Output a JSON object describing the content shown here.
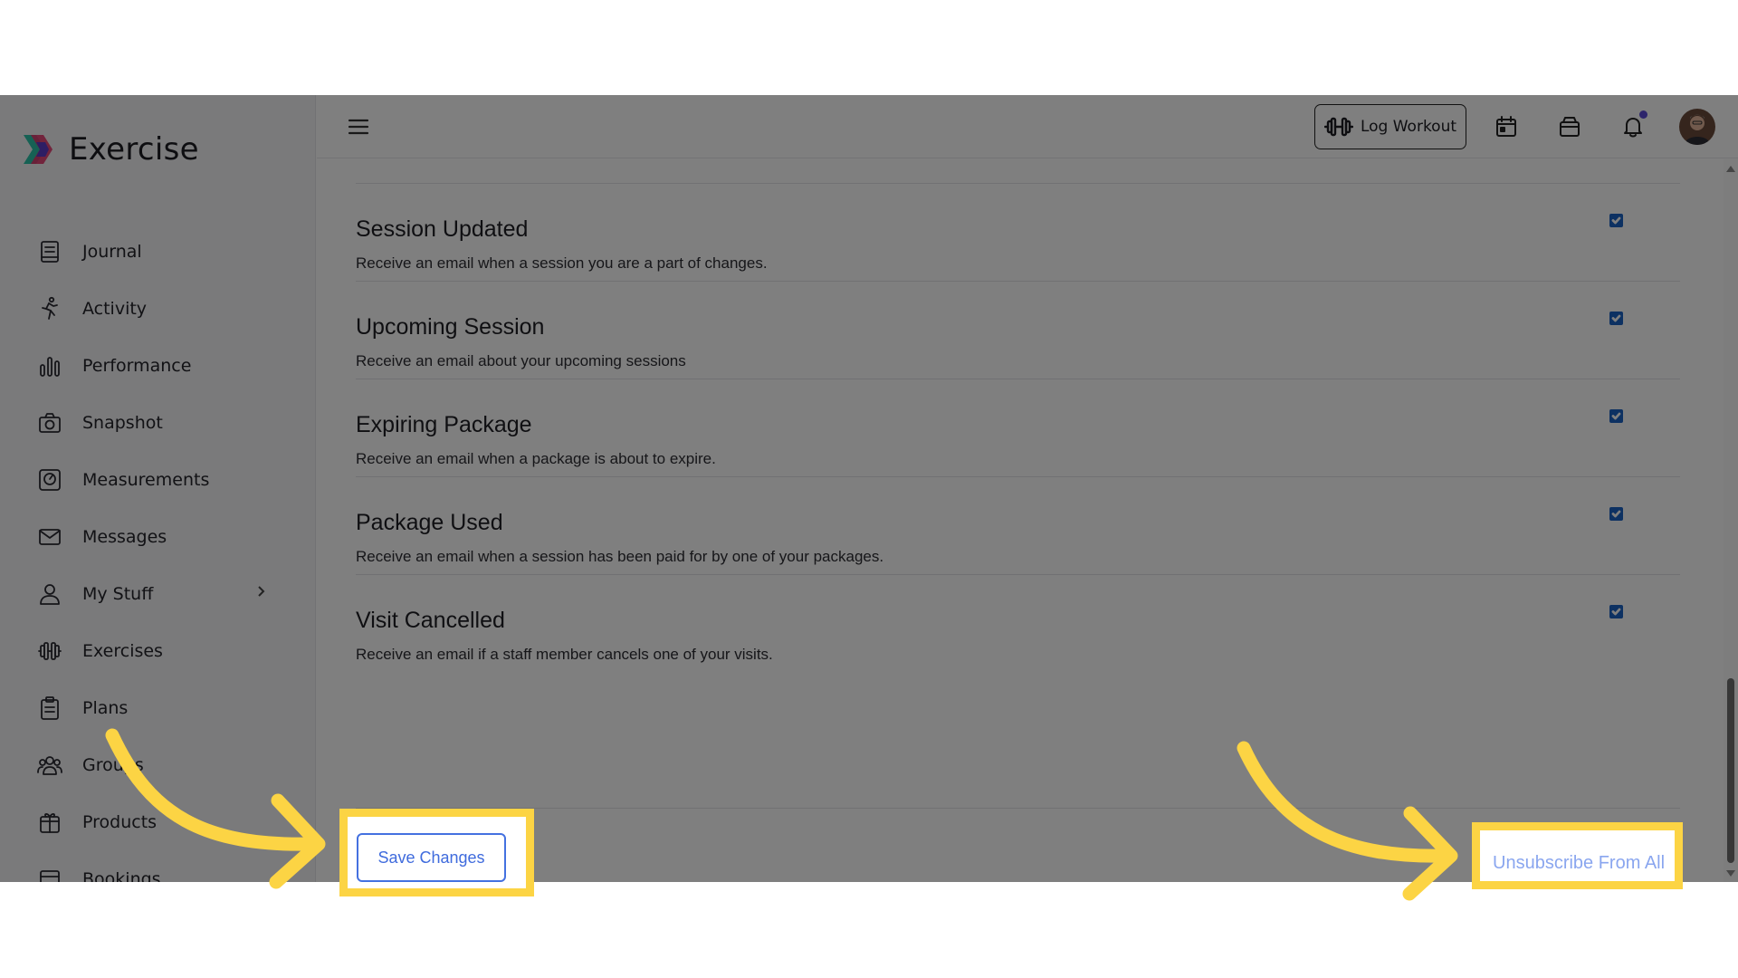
{
  "app": {
    "name": "Exercise"
  },
  "sidebar": {
    "items": [
      {
        "label": "Journal",
        "icon": "journal-icon"
      },
      {
        "label": "Activity",
        "icon": "running-icon"
      },
      {
        "label": "Performance",
        "icon": "bar-chart-icon"
      },
      {
        "label": "Snapshot",
        "icon": "camera-icon"
      },
      {
        "label": "Measurements",
        "icon": "scale-icon"
      },
      {
        "label": "Messages",
        "icon": "envelope-icon"
      },
      {
        "label": "My Stuff",
        "icon": "user-icon",
        "has_submenu": true
      },
      {
        "label": "Exercises",
        "icon": "dumbbell-icon"
      },
      {
        "label": "Plans",
        "icon": "clipboard-icon"
      },
      {
        "label": "Groups",
        "icon": "users-icon"
      },
      {
        "label": "Products",
        "icon": "gift-icon"
      },
      {
        "label": "Bookings",
        "icon": "calendar-list-icon"
      }
    ]
  },
  "topbar": {
    "log_workout_label": "Log Workout",
    "icons": [
      "calendar-icon",
      "shop-bag-icon",
      "bell-icon",
      "avatar"
    ],
    "notification_dot_color": "#5b4bd6"
  },
  "settings": [
    {
      "title": "Session Updated",
      "description": "Receive an email when a session you are a part of changes.",
      "checked": true
    },
    {
      "title": "Upcoming Session",
      "description": "Receive an email about your upcoming sessions",
      "checked": true
    },
    {
      "title": "Expiring Package",
      "description": "Receive an email when a package is about to expire.",
      "checked": true
    },
    {
      "title": "Package Used",
      "description": "Receive an email when a session has been paid for by one of your packages.",
      "checked": true
    },
    {
      "title": "Visit Cancelled",
      "description": "Receive an email if a staff member cancels one of your visits.",
      "checked": true
    }
  ],
  "actions": {
    "save_label": "Save Changes",
    "unsubscribe_label": "Unsubscribe From All"
  },
  "colors": {
    "accent": "#3d68d8",
    "checkbox": "#1a62c4",
    "highlight": "#fcd444"
  }
}
